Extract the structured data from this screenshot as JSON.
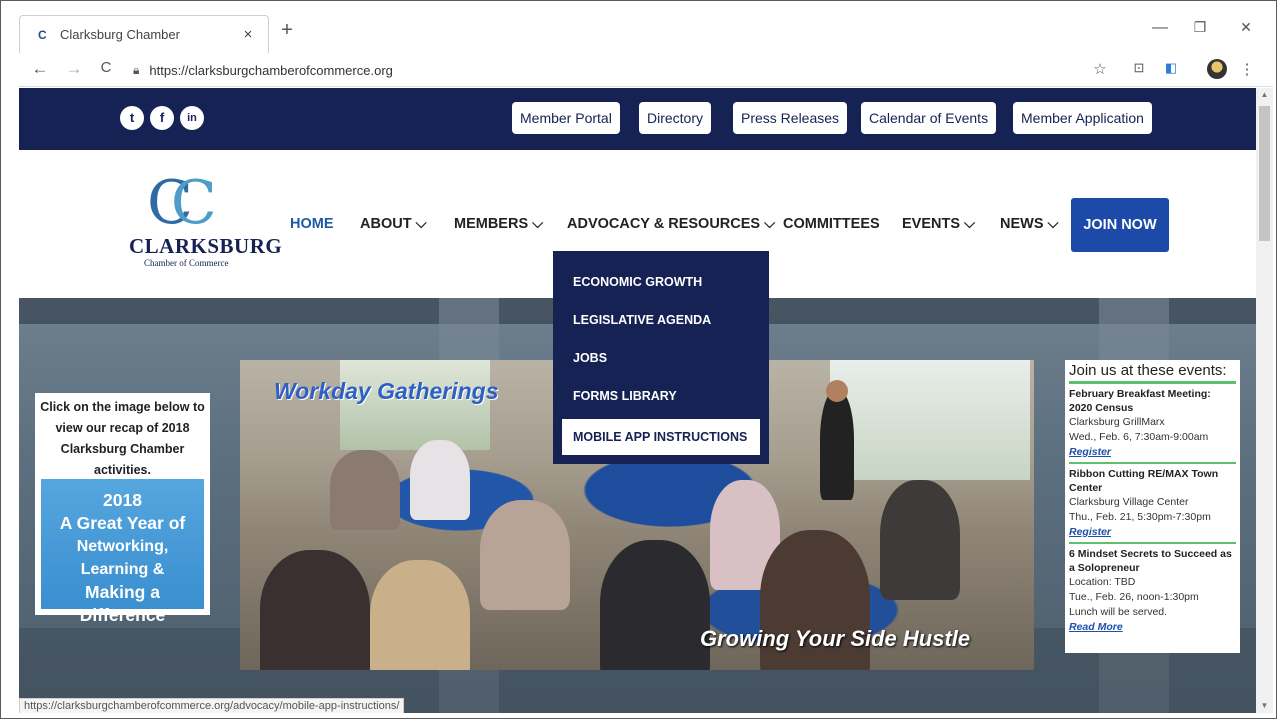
{
  "browser": {
    "tab_title": "Clarksburg Chamber",
    "tab_close": "×",
    "new_tab": "+",
    "url": "https://clarksburgchamberofcommerce.org",
    "status_url": "https://clarksburgchamberofcommerce.org/advocacy/mobile-app-instructions/",
    "window": {
      "minimize": "—",
      "restore": "❐",
      "close": "✕"
    },
    "nav": {
      "back": "←",
      "forward": "→",
      "reload": "C"
    }
  },
  "topbar": {
    "social": [
      "t",
      "f",
      "in"
    ],
    "links": [
      "Member Portal",
      "Directory",
      "Press Releases",
      "Calendar of Events",
      "Member Application"
    ]
  },
  "logo": {
    "name": "CLARKSBURG",
    "sub": "Chamber of Commerce"
  },
  "nav": {
    "items": [
      "HOME",
      "ABOUT ⌵",
      "MEMBERS ⌵",
      "ADVOCACY & RESOURCES ⌵",
      "COMMITTEES",
      "EVENTS ⌵",
      "NEWS ⌵"
    ],
    "join": "JOIN NOW"
  },
  "dropdown": [
    "ECONOMIC GROWTH",
    "LEGISLATIVE AGENDA",
    "JOBS",
    "FORMS LIBRARY",
    "MOBILE APP INSTRUCTIONS"
  ],
  "promo": {
    "text": "Click on the image below to view our recap of 2018 Clarksburg Chamber activities.",
    "box_lines": [
      "2018",
      "A Great Year of",
      "Networking, Learning &",
      "Making a Difference"
    ]
  },
  "photo": {
    "title": "Workday Gatherings",
    "caption": "Growing Your Side Hustle"
  },
  "events": {
    "heading": "Join us at these events:",
    "items": [
      {
        "title": "February Breakfast Meeting: 2020 Census",
        "lines": [
          "Clarksburg GrillMarx",
          "Wed., Feb. 6, 7:30am-9:00am"
        ],
        "link": "Register"
      },
      {
        "title": "Ribbon Cutting RE/MAX Town Center",
        "lines": [
          "Clarksburg Village Center",
          "Thu., Feb. 21, 5:30pm-7:30pm"
        ],
        "link": "Register"
      },
      {
        "title": "6 Mindset Secrets to Succeed as a Solopreneur",
        "lines": [
          "Location: TBD",
          "Tue., Feb. 26, noon-1:30pm",
          "Lunch will be served."
        ],
        "link": "Read More"
      }
    ]
  }
}
